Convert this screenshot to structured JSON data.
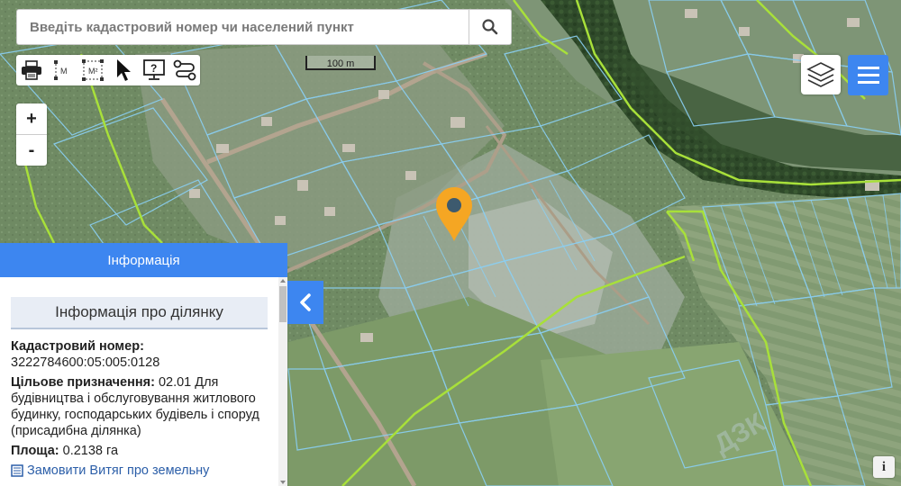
{
  "search": {
    "placeholder": "Введіть кадастровий номер чи населений пункт"
  },
  "toolbar": {
    "area_label": "M",
    "area2_label": "M²"
  },
  "zoom": {
    "in_label": "+",
    "out_label": "-"
  },
  "scalebar": {
    "label": "100 m"
  },
  "panel": {
    "header": "Інформація",
    "subheader": "Інформація про ділянку",
    "cadastral_label": "Кадастровий номер:",
    "cadastral_value": "3222784600:05:005:0128",
    "purpose_label": "Цільове призначення:",
    "purpose_value": "02.01 Для будівництва і обслуговування житлового будинку, господарських будівель і споруд (присадибна ділянка)",
    "area_label": "Площа:",
    "area_value": "0.2138 га",
    "extract_link": "Замовити Витяг про земельну"
  },
  "info_button": {
    "label": "i"
  },
  "colors": {
    "accent": "#3d86f0",
    "parcel_line": "#8ad0f5",
    "boundary_line": "#a8e03a",
    "marker": "#f5a623"
  },
  "icons": [
    "search-icon",
    "printer-icon",
    "measure-distance-icon",
    "measure-area-icon",
    "pointer-icon",
    "help-icon",
    "route-icon",
    "layers-icon",
    "menu-icon",
    "chevron-left-icon",
    "map-marker-icon",
    "info-icon",
    "document-icon"
  ]
}
